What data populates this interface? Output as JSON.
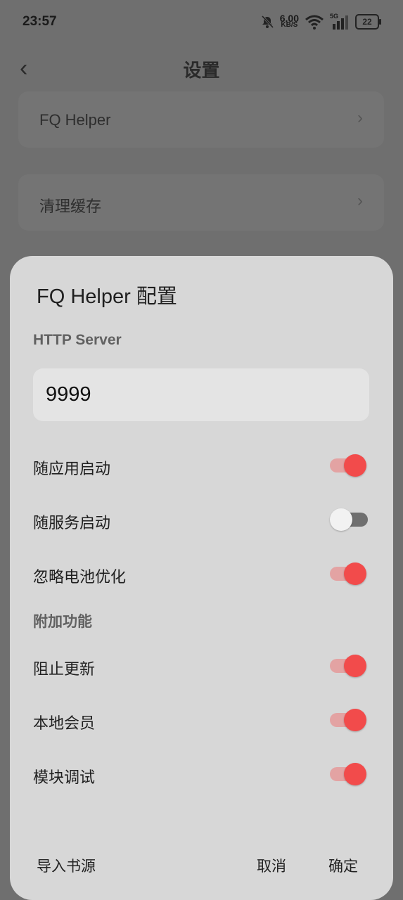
{
  "status_bar": {
    "time": "23:57",
    "speed_value": "6.00",
    "speed_unit": "KB/S",
    "network": "5G",
    "battery": "22"
  },
  "background": {
    "title": "设置",
    "items": [
      {
        "label": "FQ Helper"
      },
      {
        "label": "清理缓存"
      }
    ]
  },
  "dialog": {
    "title": "FQ Helper 配置",
    "http_section": "HTTP Server",
    "port_value": "9999",
    "toggles_main": [
      {
        "label": "随应用启动",
        "on": true
      },
      {
        "label": "随服务启动",
        "on": false
      },
      {
        "label": "忽略电池优化",
        "on": true
      }
    ],
    "extra_section": "附加功能",
    "toggles_extra": [
      {
        "label": "阻止更新",
        "on": true
      },
      {
        "label": "本地会员",
        "on": true
      },
      {
        "label": "模块调试",
        "on": true
      }
    ],
    "buttons": {
      "import": "导入书源",
      "cancel": "取消",
      "confirm": "确定"
    }
  },
  "colors": {
    "accent": "#f24b4b",
    "accent_track": "#e3a3a3",
    "sheet_bg": "#d7d7d7",
    "scrim": "#6f6f6f"
  }
}
